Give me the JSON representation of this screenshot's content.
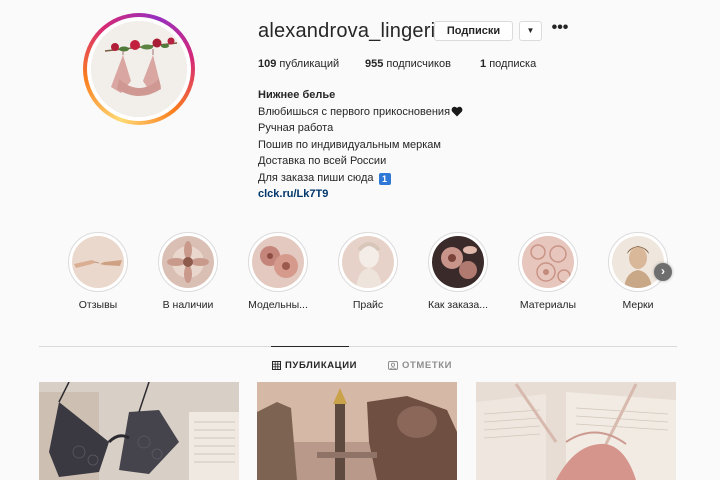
{
  "profile": {
    "username": "alexandrova_lingerie",
    "subscribe_button": "Подписки",
    "dropdown_glyph": "▼",
    "more_glyph": "•••",
    "stats": [
      {
        "count": "109",
        "label": "публикаций"
      },
      {
        "count": "955",
        "label": "подписчиков"
      },
      {
        "count": "1",
        "label": "подписка"
      }
    ],
    "bio": {
      "name": "Нижнее белье",
      "lines": [
        "Влюбишься с первого прикосновения",
        "Ручная работа",
        "Пошив по индивидуальным меркам",
        "Доставка по всей России",
        "Для заказа пиши сюда"
      ],
      "badge_number": "1",
      "link": "clck.ru/Lk7T9"
    }
  },
  "highlights": [
    {
      "label": "Отзывы",
      "icon": "hands-image"
    },
    {
      "label": "В наличии",
      "icon": "flower-image"
    },
    {
      "label": "Модельны...",
      "icon": "flower-image"
    },
    {
      "label": "Прайс",
      "icon": "bust-image"
    },
    {
      "label": "Как заказа...",
      "icon": "dark-flower-image"
    },
    {
      "label": "Материалы",
      "icon": "lace-image"
    },
    {
      "label": "Мерки",
      "icon": "portrait-image"
    }
  ],
  "highlights_next_glyph": "›",
  "tabs": [
    {
      "label": "ПУБЛИКАЦИИ",
      "icon": "grid-icon",
      "active": true
    },
    {
      "label": "ОТМЕТКИ",
      "icon": "tag-icon",
      "active": false
    }
  ],
  "posts": [
    {
      "icon": "lace-bra-on-book-image"
    },
    {
      "icon": "paris-bridge-statue-image"
    },
    {
      "icon": "bra-on-open-book-image"
    }
  ],
  "colors": {
    "link": "#00376b",
    "text": "#262626",
    "muted": "#8e8e8e",
    "border": "#dbdbdb",
    "background": "#fafafa"
  }
}
